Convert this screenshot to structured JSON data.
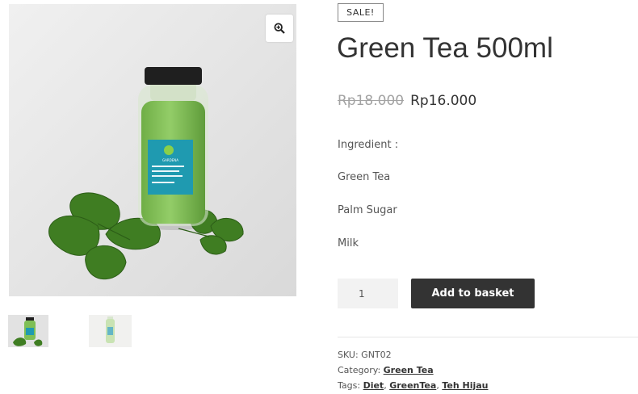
{
  "badge": {
    "sale": "SALE!"
  },
  "product": {
    "title": "Green Tea 500ml",
    "price_old": "Rp18.000",
    "price_new": "Rp16.000"
  },
  "description": {
    "heading": "Ingredient :",
    "ingredients": [
      "Green Tea",
      "Palm Sugar",
      "Milk"
    ]
  },
  "cart": {
    "quantity": "1",
    "add_label": "Add to basket"
  },
  "meta": {
    "sku_label": "SKU:",
    "sku_value": "GNT02",
    "category_label": "Category:",
    "category_value": "Green Tea",
    "tags_label": "Tags:",
    "tags": [
      "Diet",
      "GreenTea",
      "Teh Hijau"
    ]
  },
  "gallery": {
    "zoom_icon": "magnifier-plus-icon",
    "bottle_label_brand": "GARDENA"
  },
  "colors": {
    "button": "#333333",
    "tea": "#7fbf55",
    "leaf": "#3f7d22",
    "cap": "#1f1f1f"
  }
}
